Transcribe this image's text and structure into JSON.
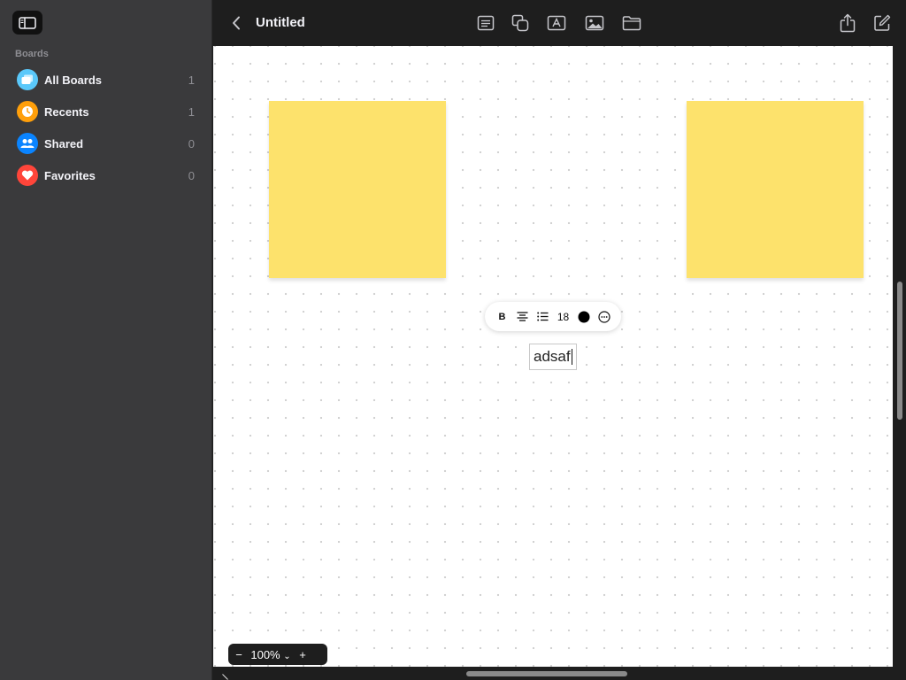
{
  "sidebar": {
    "section_title": "Boards",
    "items": [
      {
        "label": "All Boards",
        "count": "1",
        "icon": "all-boards-icon",
        "color": "#5ac8fa"
      },
      {
        "label": "Recents",
        "count": "1",
        "icon": "clock-icon",
        "color": "#ff9f0a"
      },
      {
        "label": "Shared",
        "count": "0",
        "icon": "people-icon",
        "color": "#0a84ff"
      },
      {
        "label": "Favorites",
        "count": "0",
        "icon": "heart-icon",
        "color": "#ff453a"
      }
    ]
  },
  "toolbar": {
    "title": "Untitled",
    "tools": [
      "sticky-note-icon",
      "shapes-icon",
      "text-box-icon",
      "media-icon",
      "folder-icon",
      "share-icon",
      "new-board-icon"
    ]
  },
  "canvas": {
    "sticky_color": "#fde26c",
    "text_box": {
      "value": "adsaf"
    },
    "format_bar": {
      "bold": "B",
      "font_size": "18",
      "text_color": "#000000"
    }
  },
  "zoom": {
    "minus": "−",
    "value": "100%",
    "plus": "+"
  },
  "colors": {
    "accent": "#fde26c",
    "sidebar_bg": "#3a3a3c",
    "toolbar_bg": "#1e1e1e"
  }
}
